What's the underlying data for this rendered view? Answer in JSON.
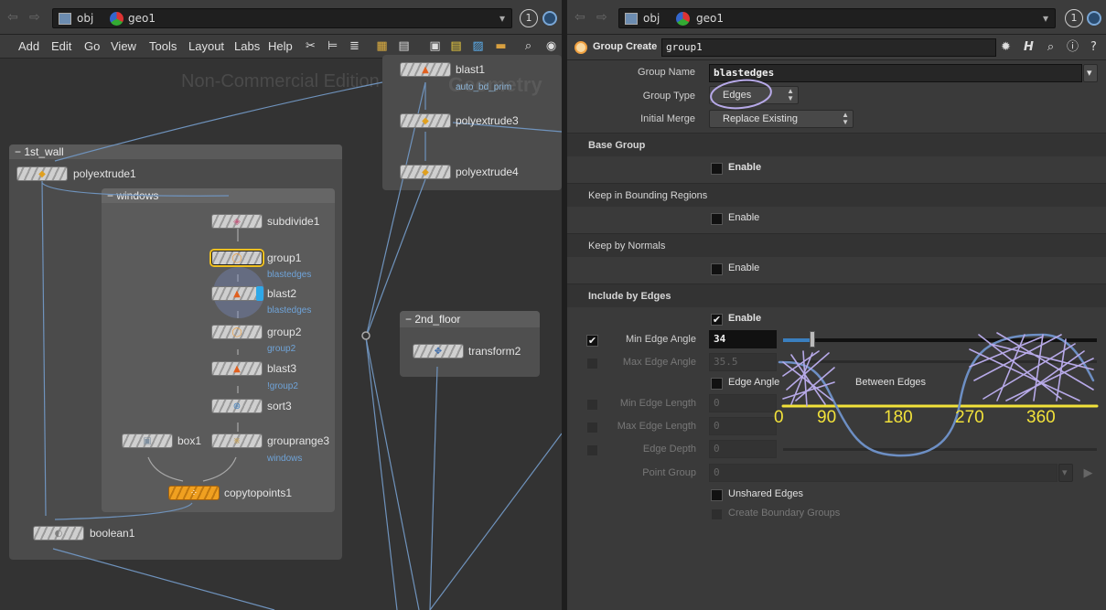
{
  "network_pane": {
    "path": {
      "back_label": "⇦",
      "forward_label": "⇨",
      "crumb1": "obj",
      "crumb2": "geo1",
      "dropdown": "▾",
      "pin": "1"
    },
    "menu": [
      "Add",
      "Edit",
      "Go",
      "View",
      "Tools",
      "Layout",
      "Labs",
      "Help"
    ],
    "watermark": "Non-Commercial Edition",
    "context_label": "Geometry",
    "boxes": {
      "first": "1st_wall",
      "windows": "windows",
      "second": "2nd_floor"
    },
    "nodes": {
      "blast1": "blast1",
      "blast1_sub": "auto_bd_prim",
      "polyextrude3": "polyextrude3",
      "polyextrude4": "polyextrude4",
      "polyextrude1": "polyextrude1",
      "subdivide1": "subdivide1",
      "group1": "group1",
      "group1_sub": "blastedges",
      "blast2": "blast2",
      "blast2_sub": "blastedges",
      "group2": "group2",
      "group2_sub": "group2",
      "blast3": "blast3",
      "blast3_sub": "!group2",
      "sort3": "sort3",
      "box1": "box1",
      "grouprange3": "grouprange3",
      "grouprange3_sub": "windows",
      "copytopoints1": "copytopoints1",
      "boolean1": "boolean1",
      "transform2": "transform2"
    },
    "colors": {
      "selected": "#f0c020",
      "display": "#2ea8e8",
      "copy_node": "#f0a020",
      "wire": "#6f93bd"
    }
  },
  "param_pane": {
    "path": {
      "crumb1": "obj",
      "crumb2": "geo1",
      "pin": "1"
    },
    "header": {
      "node_type": "Group Create",
      "node_name": "group1"
    },
    "params": {
      "group_name_label": "Group Name",
      "group_name": "blastedges",
      "group_type_label": "Group Type",
      "group_type": "Edges",
      "initial_merge_label": "Initial Merge",
      "initial_merge": "Replace Existing"
    },
    "sections": {
      "base": "Base Group",
      "bounding": "Keep in Bounding Regions",
      "normals": "Keep by Normals",
      "edges": "Include by Edges"
    },
    "enable_label": "Enable",
    "edges": {
      "min_angle_label": "Min Edge Angle",
      "min_angle": "34",
      "min_angle_slider_deg": 34,
      "max_angle_label": "Max Edge Angle",
      "max_angle": "35.5",
      "edge_angle_label": "Edge Angle",
      "edge_angle_tail": "Between Edges",
      "min_length_label": "Min Edge Length",
      "min_length": "0",
      "max_length_label": "Max Edge Length",
      "max_length": "0",
      "depth_label": "Edge Depth",
      "depth": "0",
      "point_group_label": "Point Group",
      "point_group": "0"
    },
    "unshared_label": "Unshared Edges",
    "boundary_label": "Create Boundary Groups",
    "scale_marks": [
      "0",
      "90",
      "180",
      "270",
      "360"
    ],
    "colors": {
      "annotation": "#f2e23a",
      "scribble": "#b7a9e8",
      "curve": "#6d8fc4"
    }
  }
}
